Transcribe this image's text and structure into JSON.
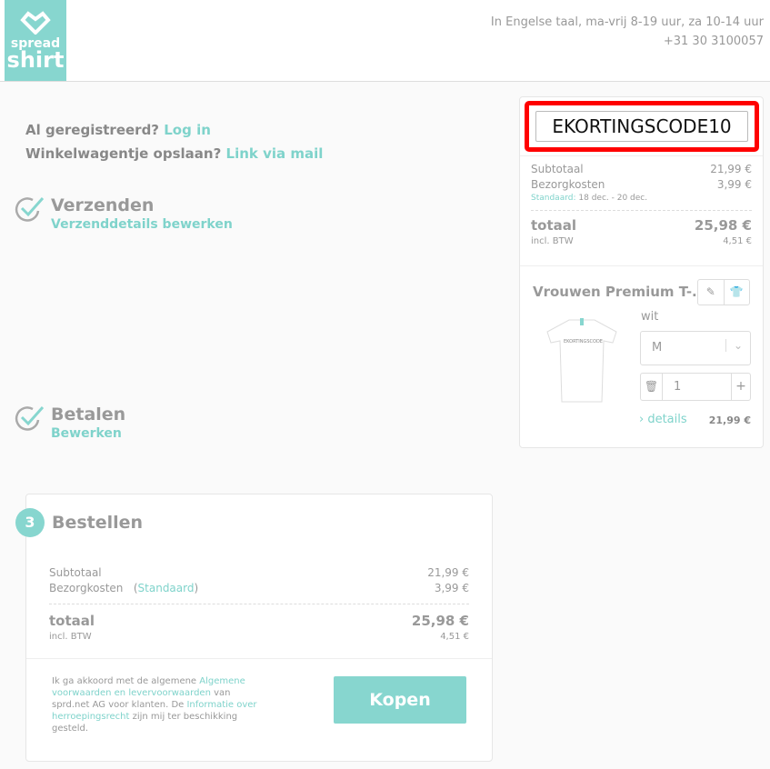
{
  "header": {
    "logo_top": "spread",
    "logo_bottom": "shirt",
    "contact_hours": "In Engelse taal, ma-vrij 8-19 uur, za 10-14 uur",
    "phone": "+31 30 3100057"
  },
  "login": {
    "registered": "Al geregistreerd?",
    "login_link": "Log in",
    "save_cart": "Winkelwagentje opslaan?",
    "mail_link": "Link via mail"
  },
  "steps": [
    {
      "title": "Verzenden",
      "edit": "Verzenddetails bewerken"
    },
    {
      "title": "Betalen",
      "edit": "Bewerken"
    },
    {
      "number": "3",
      "title": "Bestellen"
    }
  ],
  "order": {
    "subtotal_label": "Subtotaal",
    "subtotal": "21,99 €",
    "shipping_label": "Bezorgkosten",
    "shipping_type": "Standaard",
    "shipping": "3,99 €",
    "total_label": "totaal",
    "total": "25,98 €",
    "vat_label": "incl. BTW",
    "vat": "4,51 €",
    "terms": {
      "t1": "Ik ga akkoord met de algemene ",
      "link1": "Algemene voorwaarden en levervoorwaarden",
      "t2": " van sprd.net AG voor klanten. De ",
      "link2": "Informatie over herroepingsrecht",
      "t3": " zijn mij ter beschikking gesteld."
    },
    "buy_label": "Kopen"
  },
  "sidebar": {
    "coupon_value": "EKORTINGSCODE10",
    "subtotal_label": "Subtotaal",
    "subtotal": "21,99 €",
    "shipping_label": "Bezorgkosten",
    "shipping": "3,99 €",
    "delivery_type": "Standaard:",
    "delivery_dates": "18 dec. - 20 dec.",
    "total_label": "totaal",
    "total": "25,98 €",
    "vat_label": "incl. BTW",
    "vat": "4,51 €",
    "product": {
      "name": "Vrouwen Premium T-...",
      "print_text": "EKORTINGSCODE",
      "color": "wit",
      "size": "M",
      "quantity": "1",
      "details_link": "› details",
      "price": "21,99 €"
    }
  },
  "colors": {
    "accent": "#87d6cf",
    "highlight": "#ff0000"
  }
}
